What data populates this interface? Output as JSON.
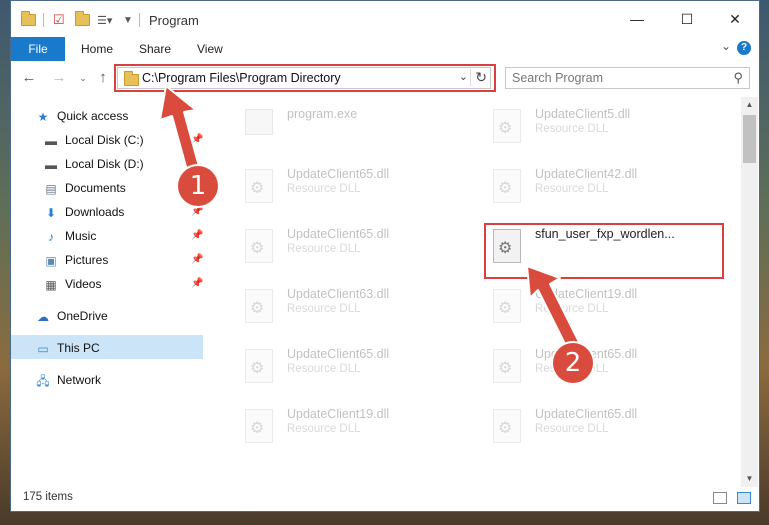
{
  "window": {
    "title": "Program",
    "minimize": "—",
    "maximize": "☐",
    "close": "✕"
  },
  "ribbon": {
    "file": "File",
    "home": "Home",
    "share": "Share",
    "view": "View",
    "help": "?"
  },
  "address": {
    "path": "C:\\Program Files\\Program Directory",
    "search_placeholder": "Search Program"
  },
  "nav_pane": {
    "quick_access": "Quick access",
    "local_c": "Local Disk (C:)",
    "local_d": "Local Disk (D:)",
    "documents": "Documents",
    "downloads": "Downloads",
    "music": "Music",
    "pictures": "Pictures",
    "videos": "Videos",
    "onedrive": "OneDrive",
    "this_pc": "This PC",
    "network": "Network"
  },
  "files": [
    {
      "name": "program.exe",
      "type": ""
    },
    {
      "name": "UpdateClient5.dll",
      "type": "Resource DLL"
    },
    {
      "name": "UpdateClient65.dll",
      "type": "Resource DLL"
    },
    {
      "name": "UpdateClient42.dll",
      "type": "Resource DLL"
    },
    {
      "name": "UpdateClient65.dll",
      "type": "Resource DLL"
    },
    {
      "name": "sfun_user_fxp_wordlen...",
      "type": ""
    },
    {
      "name": "UpdateClient63.dll",
      "type": "Resource DLL"
    },
    {
      "name": "UpdateClient19.dll",
      "type": "Resource DLL"
    },
    {
      "name": "UpdateClient65.dll",
      "type": "Resource DLL"
    },
    {
      "name": "UpdateClient65.dll",
      "type": "Resource DLL"
    },
    {
      "name": "UpdateClient19.dll",
      "type": "Resource DLL"
    },
    {
      "name": "UpdateClient65.dll",
      "type": "Resource DLL"
    }
  ],
  "status": {
    "count": "175 items"
  },
  "annotations": {
    "step1": "1",
    "step2": "2",
    "color": "#d94b3c"
  }
}
